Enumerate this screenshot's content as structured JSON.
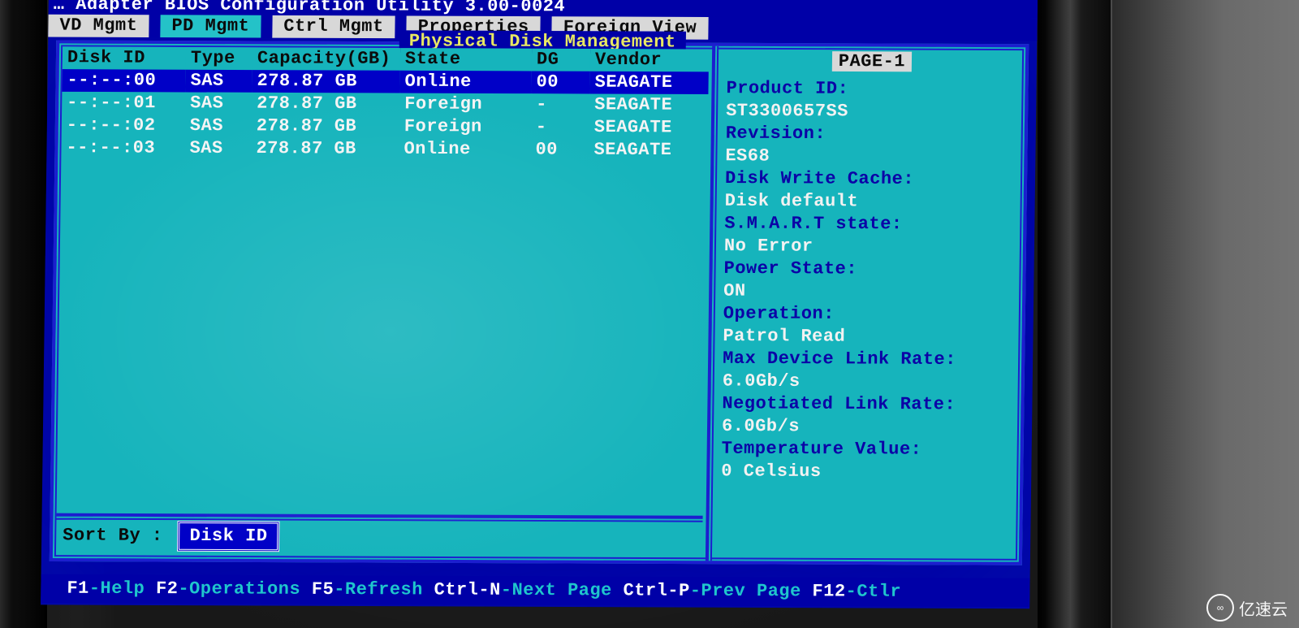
{
  "title_partial": "… Adapter BIOS Configuration Utility 3.00-0024",
  "tabs": {
    "items": [
      "VD Mgmt",
      "PD Mgmt",
      "Ctrl Mgmt",
      "Properties",
      "Foreign View"
    ],
    "selected_index": 1
  },
  "panel_title": "Physical Disk Management",
  "columns": [
    "Disk ID",
    "Type",
    "Capacity(GB)",
    "State",
    "DG",
    "Vendor"
  ],
  "rows": [
    {
      "disk_id": "--:--:00",
      "type": "SAS",
      "capacity": "278.87 GB",
      "state": "Online",
      "dg": "00",
      "vendor": "SEAGATE",
      "selected": true
    },
    {
      "disk_id": "--:--:01",
      "type": "SAS",
      "capacity": "278.87 GB",
      "state": "Foreign",
      "dg": "-",
      "vendor": "SEAGATE",
      "selected": false
    },
    {
      "disk_id": "--:--:02",
      "type": "SAS",
      "capacity": "278.87 GB",
      "state": "Foreign",
      "dg": "-",
      "vendor": "SEAGATE",
      "selected": false
    },
    {
      "disk_id": "--:--:03",
      "type": "SAS",
      "capacity": "278.87 GB",
      "state": "Online",
      "dg": "00",
      "vendor": "SEAGATE",
      "selected": false
    }
  ],
  "sort": {
    "label": "Sort By :",
    "value": "Disk ID"
  },
  "detail": {
    "page_tag": "PAGE-1",
    "fields": [
      {
        "k": "Product ID:",
        "v": "ST3300657SS"
      },
      {
        "k": "Revision:",
        "v": "ES68"
      },
      {
        "k": "Disk Write Cache:",
        "v": "Disk default"
      },
      {
        "k": "S.M.A.R.T state:",
        "v": "No Error"
      },
      {
        "k": "Power State:",
        "v": "ON"
      },
      {
        "k": "Operation:",
        "v": "Patrol Read"
      },
      {
        "k": "Max Device Link Rate:",
        "v": "6.0Gb/s"
      },
      {
        "k": "Negotiated Link Rate:",
        "v": "6.0Gb/s"
      },
      {
        "k": "Temperature Value:",
        "v": "0 Celsius"
      }
    ]
  },
  "footer": [
    {
      "key": "F1",
      "desc": "Help"
    },
    {
      "key": "F2",
      "desc": "Operations"
    },
    {
      "key": "F5",
      "desc": "Refresh"
    },
    {
      "key": "Ctrl-N",
      "desc": "Next Page"
    },
    {
      "key": "Ctrl-P",
      "desc": "Prev Page"
    },
    {
      "key": "F12",
      "desc": "Ctlr"
    }
  ],
  "watermark": "亿速云"
}
